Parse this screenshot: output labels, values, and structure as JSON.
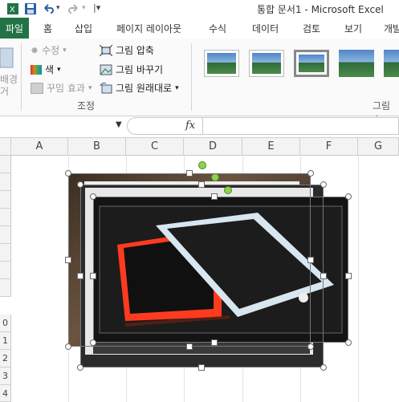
{
  "window": {
    "title": "통합 문서1 - Microsoft Excel"
  },
  "tabs": [
    {
      "label": "파일"
    },
    {
      "label": "홈"
    },
    {
      "label": "삽입"
    },
    {
      "label": "페이지 레이아웃"
    },
    {
      "label": "수식"
    },
    {
      "label": "데이터"
    },
    {
      "label": "검토"
    },
    {
      "label": "보기"
    },
    {
      "label": "개발"
    }
  ],
  "ribbon": {
    "left_partial": {
      "line1": "배경",
      "line2": "거"
    },
    "adjust": {
      "correct": "수정",
      "color": "색",
      "artistic": "꾸밈 효과",
      "compress": "그림 압축",
      "change": "그림 바꾸기",
      "reset": "그림 원래대로",
      "group_label": "조정"
    },
    "styles": {
      "group_label": "그림 스"
    }
  },
  "formula_bar": {
    "fx": "fx",
    "value": ""
  },
  "columns": [
    "A",
    "B",
    "C",
    "D",
    "E",
    "F",
    "G"
  ],
  "rows": [
    "",
    "",
    "",
    "",
    "",
    "",
    "",
    "",
    "0",
    "1",
    "2",
    "3",
    "4"
  ]
}
